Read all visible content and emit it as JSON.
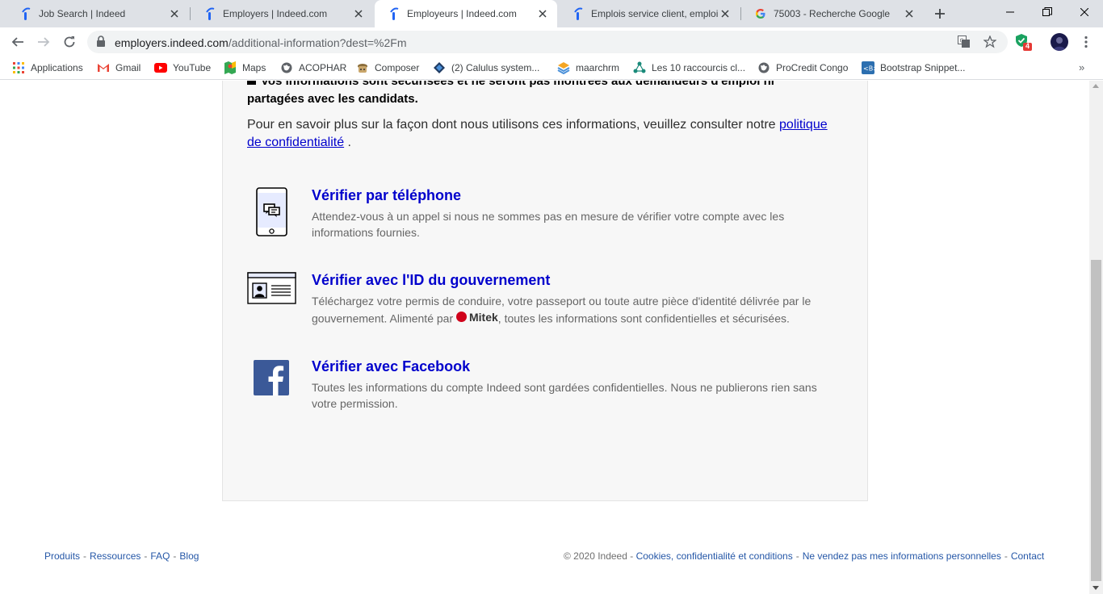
{
  "browser": {
    "tabs": [
      {
        "title": "Job Search | Indeed",
        "favicon": "indeed-icon",
        "active": false
      },
      {
        "title": "Employers | Indeed.com",
        "favicon": "indeed-icon",
        "active": false
      },
      {
        "title": "Employeurs | Indeed.com",
        "favicon": "indeed-icon",
        "active": true
      },
      {
        "title": "Emplois service client, emploi |",
        "favicon": "indeed-icon",
        "active": false
      },
      {
        "title": "75003 - Recherche Google",
        "favicon": "google-icon",
        "active": false
      }
    ],
    "url_host": "employers.indeed.com",
    "url_path": "/additional-information?dest=%2Fm",
    "extension_badge": "4"
  },
  "bookmarks": [
    {
      "label": "Applications",
      "icon": "apps-grid-icon"
    },
    {
      "label": "Gmail",
      "icon": "gmail-icon"
    },
    {
      "label": "YouTube",
      "icon": "youtube-icon"
    },
    {
      "label": "Maps",
      "icon": "maps-icon"
    },
    {
      "label": "ACOPHAR",
      "icon": "globe-icon"
    },
    {
      "label": "Composer",
      "icon": "composer-icon"
    },
    {
      "label": "(2) Calulus system...",
      "icon": "calulus-icon"
    },
    {
      "label": "maarchrm",
      "icon": "maarch-icon"
    },
    {
      "label": "Les 10 raccourcis cl...",
      "icon": "network-icon"
    },
    {
      "label": "ProCredit Congo",
      "icon": "globe-icon"
    },
    {
      "label": "Bootstrap Snippet...",
      "icon": "bootstrap-icon"
    }
  ],
  "content": {
    "secure_notice": "Vos informations sont sécurisées et ne seront pas montrées aux demandeurs d'emploi ni partagées avec les candidats.",
    "privacy_text": "Pour en savoir plus sur la façon dont nous utilisons ces informations, veuillez consulter notre ",
    "privacy_link": "politique de confidentialité",
    "privacy_end": " .",
    "options": [
      {
        "title": "Vérifier par téléphone",
        "desc": "Attendez-vous à un appel si nous ne sommes pas en mesure de vérifier votre compte avec les informations fournies.",
        "icon": "phone-icon"
      },
      {
        "title": "Vérifier avec l'ID du gouvernement",
        "desc_before": "Téléchargez votre permis de conduire, votre passeport ou toute autre pièce d'identité délivrée par le gouvernement. Alimenté par ",
        "brand": "Mitek",
        "desc_after": ", toutes les informations sont confidentielles et sécurisées.",
        "icon": "id-card-icon"
      },
      {
        "title": "Vérifier avec Facebook",
        "desc": "Toutes les informations du compte Indeed sont gardées confidentielles. Nous ne publierons rien sans votre permission.",
        "icon": "facebook-icon"
      }
    ]
  },
  "footer": {
    "left_links": [
      "Produits",
      "Ressources",
      "FAQ",
      "Blog"
    ],
    "copyright": "© 2020 Indeed - ",
    "right_links": [
      "Cookies, confidentialité et conditions",
      "Ne vendez pas mes informations personnelles",
      "Contact"
    ]
  },
  "colors": {
    "link": "#0000cc",
    "footer_link": "#2557a7",
    "card_bg": "#f7f7f7",
    "facebook": "#3b5998"
  }
}
